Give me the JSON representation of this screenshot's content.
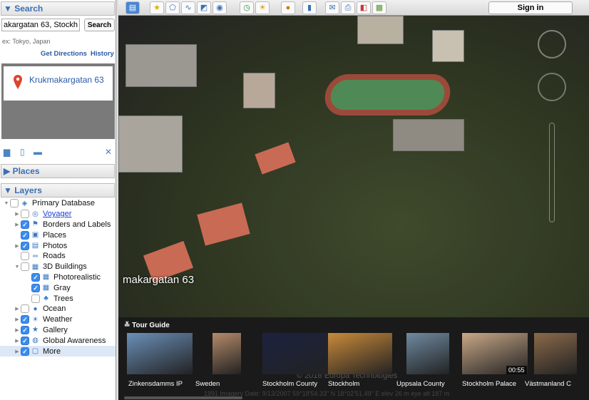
{
  "search": {
    "header": "▼ Search",
    "value": "akargatan 63, Stockho",
    "button": "Search",
    "example": "ex: Tokyo, Japan",
    "get_directions": "Get Directions",
    "history": "History",
    "result": "Krukmakargatan 63"
  },
  "places": {
    "header": "▶ Places"
  },
  "layers": {
    "header": "▼ Layers",
    "items": [
      {
        "label": "Primary Database",
        "state": "partial",
        "expand": "▼",
        "indent": 0,
        "icon": "◈"
      },
      {
        "label": "Voyager",
        "state": "off",
        "expand": "▶",
        "indent": 1,
        "icon": "◎",
        "link": true
      },
      {
        "label": "Borders and Labels",
        "state": "on",
        "expand": "▶",
        "indent": 1,
        "icon": "⚑"
      },
      {
        "label": "Places",
        "state": "on",
        "expand": "",
        "indent": 1,
        "icon": "▣"
      },
      {
        "label": "Photos",
        "state": "on",
        "expand": "▶",
        "indent": 1,
        "icon": "▤"
      },
      {
        "label": "Roads",
        "state": "off",
        "expand": "",
        "indent": 1,
        "icon": "═"
      },
      {
        "label": "3D Buildings",
        "state": "partial",
        "expand": "▼",
        "indent": 1,
        "icon": "▦"
      },
      {
        "label": "Photorealistic",
        "state": "on",
        "expand": "",
        "indent": 2,
        "icon": "▦"
      },
      {
        "label": "Gray",
        "state": "on",
        "expand": "",
        "indent": 2,
        "icon": "▦"
      },
      {
        "label": "Trees",
        "state": "off",
        "expand": "",
        "indent": 2,
        "icon": "♣"
      },
      {
        "label": "Ocean",
        "state": "partial",
        "expand": "▶",
        "indent": 1,
        "icon": "●"
      },
      {
        "label": "Weather",
        "state": "on",
        "expand": "▶",
        "indent": 1,
        "icon": "☀"
      },
      {
        "label": "Gallery",
        "state": "on",
        "expand": "▶",
        "indent": 1,
        "icon": "★"
      },
      {
        "label": "Global Awareness",
        "state": "on",
        "expand": "▶",
        "indent": 1,
        "icon": "◍"
      },
      {
        "label": "More",
        "state": "on",
        "expand": "▶",
        "indent": 1,
        "icon": "▢",
        "selected": true
      }
    ]
  },
  "toolbar": {
    "sign_in": "Sign in"
  },
  "map": {
    "label": "makargatan 63"
  },
  "tour": {
    "title": "Tour Guide",
    "items": [
      {
        "label": "Zinkensdamms IP",
        "color": "#6a8fb8"
      },
      {
        "label": "Sweden",
        "color": "#b58a6a"
      },
      {
        "label": "Stockholm County",
        "color": "#1c2240"
      },
      {
        "label": "Stockholm",
        "color": "#c98a3a"
      },
      {
        "label": "Uppsala County",
        "color": "#6f8aa0"
      },
      {
        "label": "Stockholm Palace",
        "color": "#c9a888"
      },
      {
        "label": "Västmanland C",
        "color": "#8a6a4a"
      }
    ],
    "duration": "00:55",
    "credit": "© 2016 Europa Technologies",
    "status": "1991   Imagery Date: 9/13/2007   59°18'54.33\" N  18°02'51.49\" E  elev  26 m   eye alt  187 m"
  }
}
